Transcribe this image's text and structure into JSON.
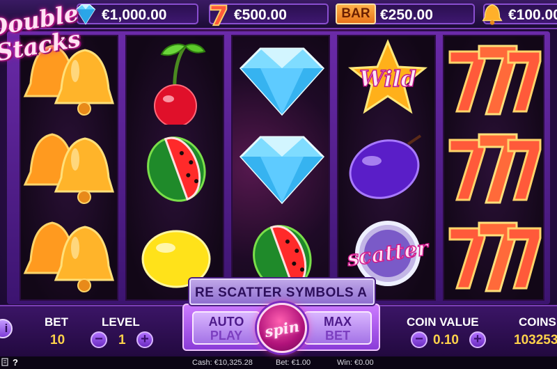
{
  "game": {
    "logo_line1": "Double",
    "logo_line2": "Stacks"
  },
  "jackpots": [
    {
      "icon": "diamond-icon",
      "value": "€1,000.00"
    },
    {
      "icon": "seven-icon",
      "value": "€500.00"
    },
    {
      "icon": "bar-icon",
      "label": "BAR",
      "value": "€250.00"
    },
    {
      "icon": "bell-icon",
      "value": "€100.00"
    }
  ],
  "reels": [
    [
      "bell",
      "bell",
      "bell"
    ],
    [
      "cherry",
      "watermelon",
      "lemon"
    ],
    [
      "diamond",
      "diamond",
      "watermelon"
    ],
    [
      "wild",
      "plum",
      "scatter"
    ],
    [
      "seven",
      "seven",
      "seven"
    ]
  ],
  "symbol_text": {
    "wild": "Wild",
    "scatter": "scatter"
  },
  "banner": {
    "message": "RE SCATTER SYMBOLS A"
  },
  "controls": {
    "bet_label": "BET",
    "bet_value": "10",
    "level_label": "LEVEL",
    "level_value": "1",
    "autoplay_line1": "AUTO",
    "autoplay_line2": "PLAY",
    "spin_label": "spin",
    "maxbet_line1": "MAX",
    "maxbet_line2": "BET",
    "coin_value_label": "COIN VALUE",
    "coin_value": "0.10",
    "coins_label": "COINS",
    "coins_value": "103253",
    "info_label": "i",
    "minus": "−",
    "plus": "+"
  },
  "status": {
    "help": "?",
    "cash": "Cash: €10,325.28",
    "bet": "Bet: €1.00",
    "win": "Win: €0.00"
  },
  "colors": {
    "accent": "#8a4fd0",
    "gold_text": "#ffd24a",
    "spin": "#b0127a"
  }
}
